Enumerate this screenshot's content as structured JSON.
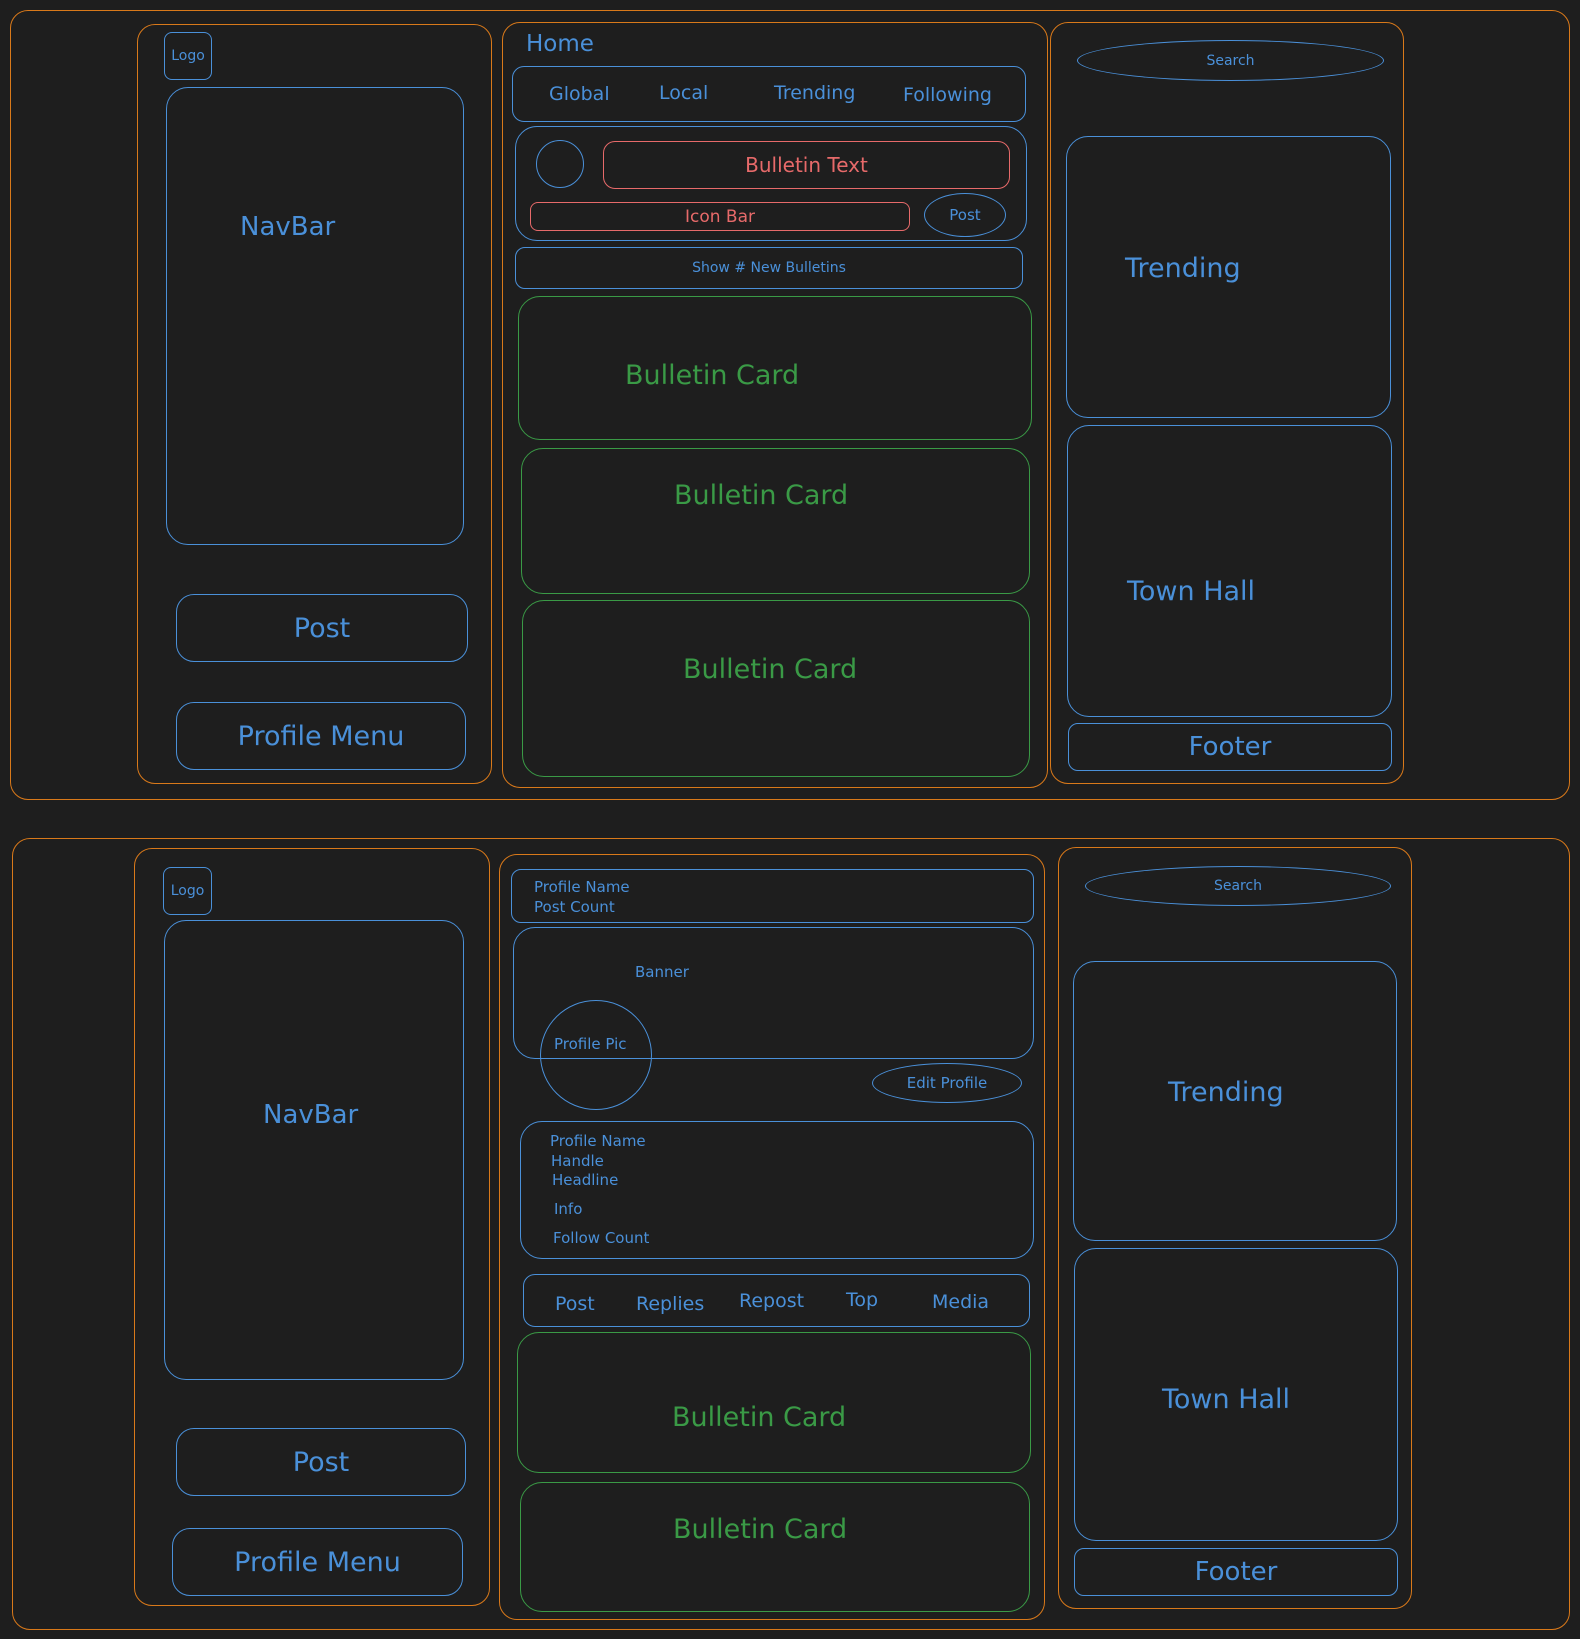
{
  "home": {
    "logo": "Logo",
    "navbar": "NavBar",
    "post_button": "Post",
    "profile_menu": "Profile Menu",
    "title": "Home",
    "tabs": [
      "Global",
      "Local",
      "Trending",
      "Following"
    ],
    "composer": {
      "bulletin_text": "Bulletin Text",
      "icon_bar": "Icon Bar",
      "post": "Post"
    },
    "show_new": "Show # New Bulletins",
    "cards": [
      "Bulletin Card",
      "Bulletin Card",
      "Bulletin Card"
    ],
    "search": "Search",
    "trending": "Trending",
    "town_hall": "Town Hall",
    "footer": "Footer"
  },
  "profile": {
    "logo": "Logo",
    "navbar": "NavBar",
    "post_button": "Post",
    "profile_menu": "Profile Menu",
    "header": {
      "name": "Profile Name",
      "post_count": "Post Count"
    },
    "banner": "Banner",
    "profile_pic": "Profile Pic",
    "edit_profile": "Edit Profile",
    "info": {
      "name": "Profile Name",
      "handle": "Handle",
      "headline": "Headline",
      "info": "Info",
      "follow_count": "Follow Count"
    },
    "tabs": [
      "Post",
      "Replies",
      "Repost",
      "Top",
      "Media"
    ],
    "cards": [
      "Bulletin Card",
      "Bulletin Card"
    ],
    "search": "Search",
    "trending": "Trending",
    "town_hall": "Town Hall",
    "footer": "Footer"
  },
  "colors": {
    "background": "#1e1e1e",
    "container": "#d9791a",
    "component": "#4a90d9",
    "composer": "#e76a6a",
    "card": "#3a9a46"
  }
}
